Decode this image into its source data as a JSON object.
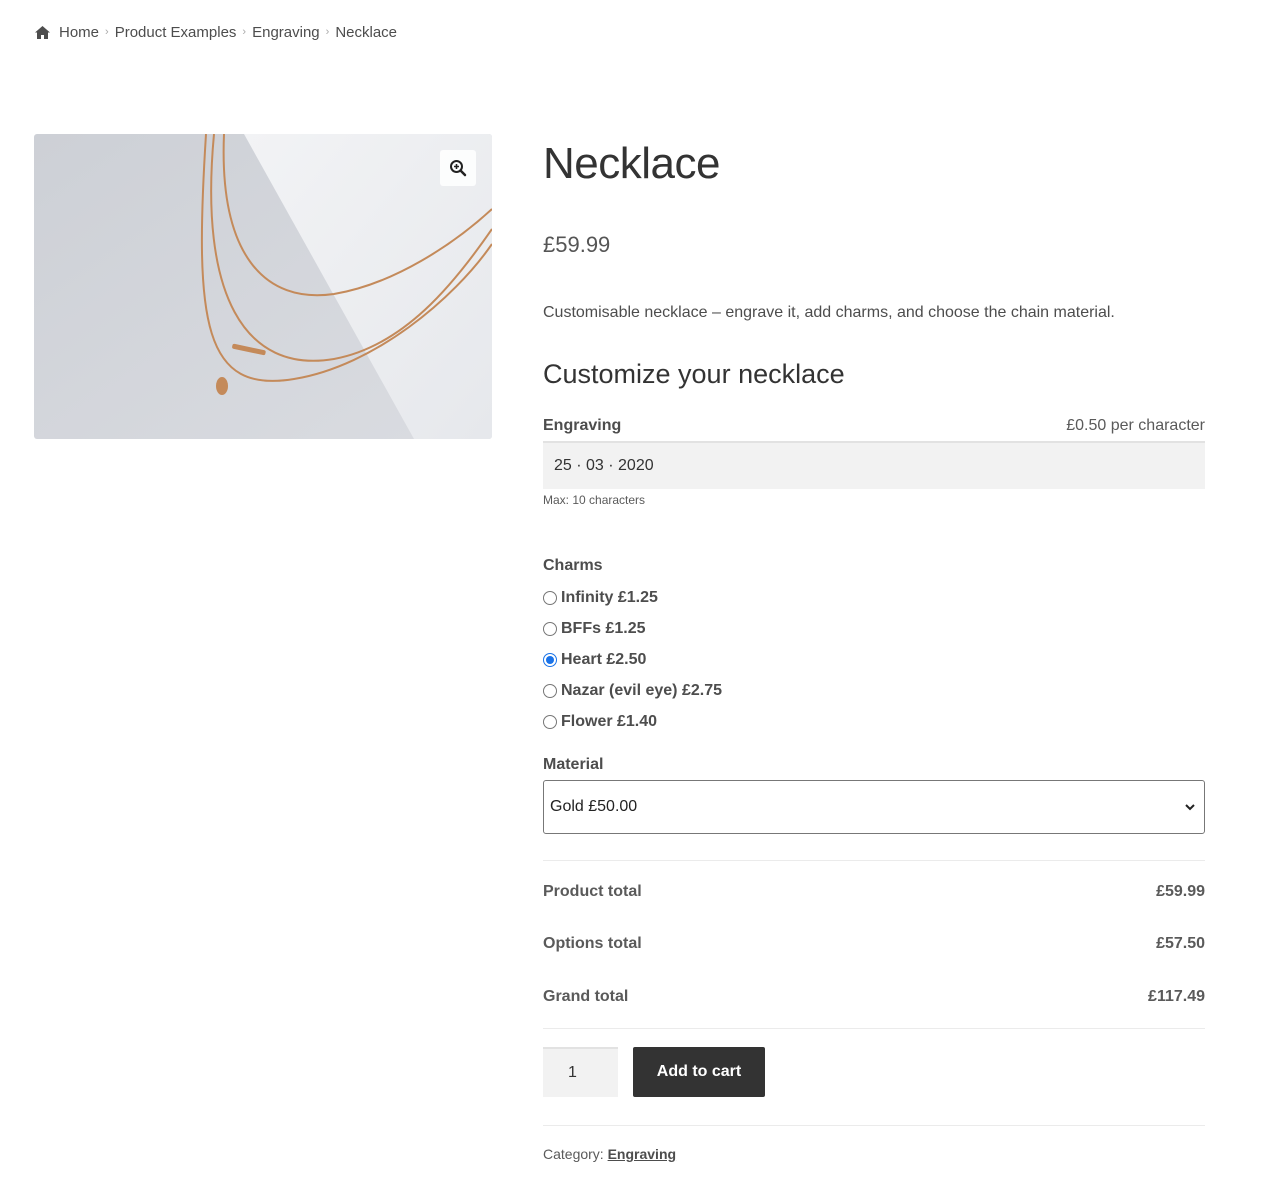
{
  "breadcrumb": {
    "items": [
      {
        "label": "Home"
      },
      {
        "label": "Product Examples"
      },
      {
        "label": "Engraving"
      },
      {
        "label": "Necklace"
      }
    ]
  },
  "product": {
    "title": "Necklace",
    "price": "£59.99",
    "description": "Customisable necklace – engrave it, add charms, and choose the chain material."
  },
  "customize": {
    "heading": "Customize your necklace",
    "engraving": {
      "label": "Engraving",
      "price_note": "£0.50 per character",
      "value": "25 · 03 · 2020",
      "hint": "Max: 10 characters"
    },
    "charms": {
      "label": "Charms",
      "options": [
        {
          "label": "Infinity £1.25",
          "checked": false
        },
        {
          "label": "BFFs £1.25",
          "checked": false
        },
        {
          "label": "Heart £2.50",
          "checked": true
        },
        {
          "label": "Nazar (evil eye) £2.75",
          "checked": false
        },
        {
          "label": "Flower £1.40",
          "checked": false
        }
      ]
    },
    "material": {
      "label": "Material",
      "selected": "Gold £50.00"
    }
  },
  "totals": [
    {
      "label": "Product total",
      "value": "£59.99"
    },
    {
      "label": "Options total",
      "value": "£57.50"
    },
    {
      "label": "Grand total",
      "value": "£117.49"
    }
  ],
  "cart": {
    "quantity": "1",
    "add_label": "Add to cart"
  },
  "meta": {
    "category_label": "Category:",
    "category_link": "Engraving"
  },
  "colors": {
    "button_bg": "#333333",
    "radio_accent": "#1a73e8",
    "input_bg": "#f2f2f2"
  },
  "icons": {
    "home": "home-icon",
    "zoom": "zoom-in-icon",
    "select": "chevron-down-icon"
  }
}
